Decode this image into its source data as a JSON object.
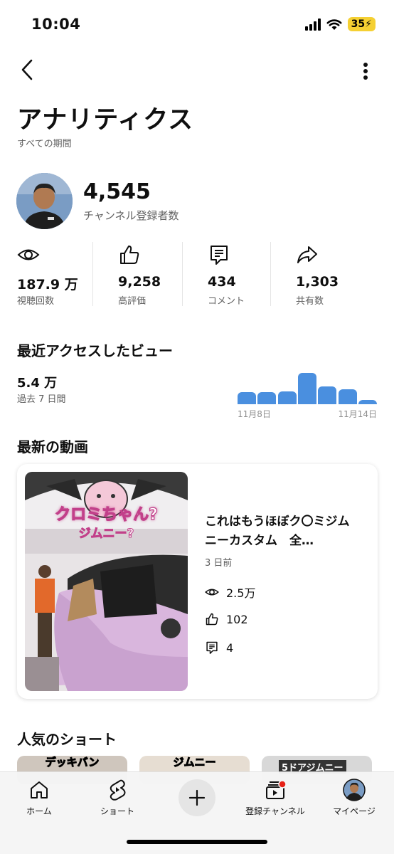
{
  "status_bar": {
    "time": "10:04",
    "battery": "35"
  },
  "header": {
    "title": "アナリティクス",
    "period": "すべての期間"
  },
  "channel": {
    "subscriber_count": "4,545",
    "subscriber_label": "チャンネル登録者数"
  },
  "stats": [
    {
      "icon": "eye-icon",
      "value": "187.9 万",
      "label": "視聴回数"
    },
    {
      "icon": "thumbs-up-icon",
      "value": "9,258",
      "label": "高評価"
    },
    {
      "icon": "comment-icon",
      "value": "434",
      "label": "コメント"
    },
    {
      "icon": "share-icon",
      "value": "1,303",
      "label": "共有数"
    }
  ],
  "recent": {
    "title": "最近アクセスしたビュー",
    "value": "5.4 万",
    "subtitle": "過去 7 日間",
    "chart_start": "11月8日",
    "chart_end": "11月14日"
  },
  "chart_data": {
    "type": "bar",
    "categories": [
      "11月8日",
      "11月9日",
      "11月10日",
      "11月11日",
      "11月12日",
      "11月13日",
      "11月14日"
    ],
    "values": [
      0.36,
      0.36,
      0.38,
      0.92,
      0.52,
      0.44,
      0.12
    ],
    "title": "",
    "xlabel": "",
    "ylabel": ""
  },
  "latest_video": {
    "section_title": "最新の動画",
    "title": "これはもうほぼク〇ミジムニーカスタム　全…",
    "date": "3 日前",
    "views": "2.5万",
    "likes": "102",
    "comments": "4",
    "thumb_caption_1": "クロミちゃん?",
    "thumb_caption_2": "ジムニー?"
  },
  "shorts": {
    "section_title": "人気のショート",
    "items": [
      "デッキバン",
      "ジムニー",
      "5ドアジムニー"
    ]
  },
  "bottom_nav": {
    "home": "ホーム",
    "shorts": "ショート",
    "subscriptions": "登録チャンネル",
    "you": "マイページ"
  },
  "colors": {
    "accent_bar": "#4a8fdf",
    "badge_red": "#e62117",
    "battery": "#f5d033"
  }
}
